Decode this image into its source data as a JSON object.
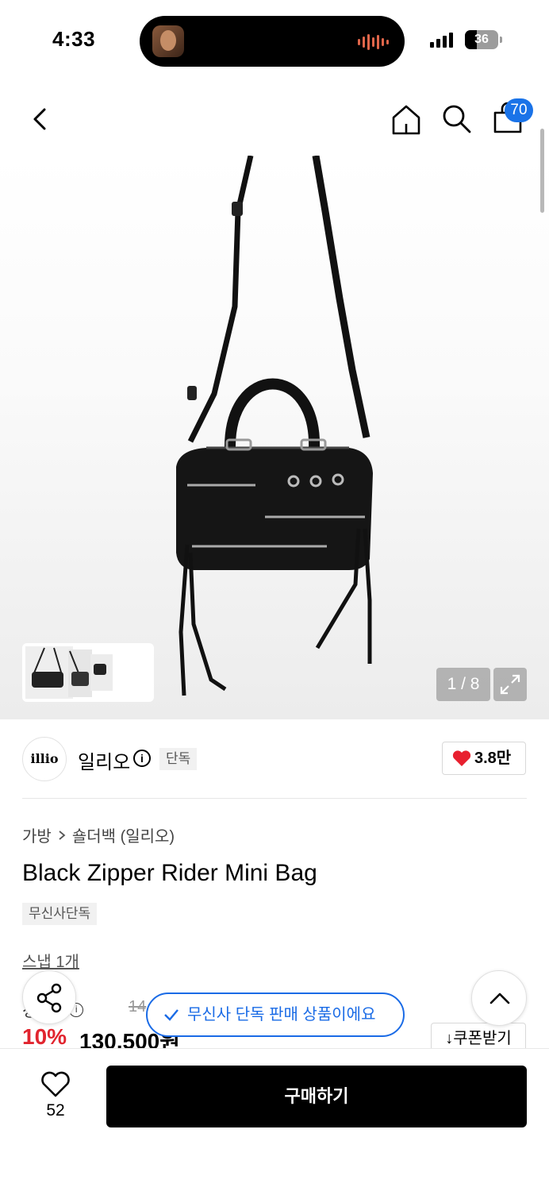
{
  "status_bar": {
    "time": "4:33",
    "battery": "36",
    "battery_level": 0.36
  },
  "header": {
    "cart_count": "70",
    "icons": [
      "back-icon",
      "home-icon",
      "search-icon",
      "cart-icon"
    ]
  },
  "gallery": {
    "pager": "1 / 8",
    "icons": [
      "expand-icon"
    ]
  },
  "brand": {
    "logo_text": "illio",
    "name": "일리오",
    "tag": "단독",
    "likes": "3.8만"
  },
  "product": {
    "breadcrumb": [
      "가방",
      "숄더백 (일리오)"
    ],
    "title": "Black Zipper Rider Mini Bag",
    "tag": "무신사단독",
    "snap_link": "스냅 1개",
    "price_label": "정상가",
    "original_price": "14",
    "discount": "10%",
    "sale_price": "130,500원",
    "coupon": "쿠폰받기"
  },
  "toast": {
    "text": "무신사 단독 판매 상품이에요"
  },
  "bottom_bar": {
    "wish_count": "52",
    "buy_label": "구매하기"
  },
  "colors": {
    "accent_blue": "#1a6be6",
    "sale_red": "#e1252f",
    "heart_red": "#e8202f"
  }
}
